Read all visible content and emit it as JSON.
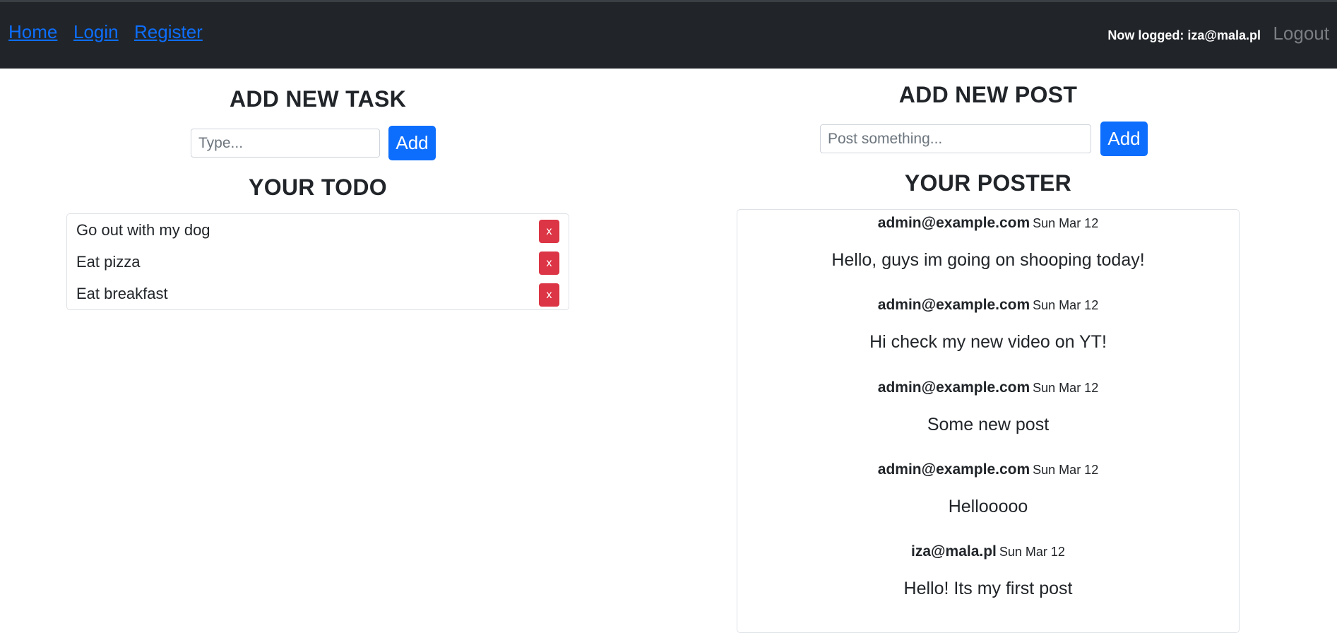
{
  "nav": {
    "links": [
      "Home",
      "Login",
      "Register"
    ],
    "user_label": "Now logged: iza@mala.pl",
    "logout": "Logout"
  },
  "tasks": {
    "heading": "ADD NEW TASK",
    "input_placeholder": "Type...",
    "add_label": "Add",
    "list_heading": "YOUR TODO",
    "items": [
      {
        "text": "Go out with my dog",
        "delete_label": "x"
      },
      {
        "text": "Eat pizza",
        "delete_label": "x"
      },
      {
        "text": "Eat breakfast",
        "delete_label": "x"
      }
    ]
  },
  "posts": {
    "heading": "ADD NEW POST",
    "input_placeholder": "Post something...",
    "add_label": "Add",
    "list_heading": "YOUR POSTER",
    "items": [
      {
        "author": "admin@example.com",
        "date": "Sun Mar 12",
        "body": "Hello, guys im going on shooping today!"
      },
      {
        "author": "admin@example.com",
        "date": "Sun Mar 12",
        "body": "Hi check my new video on YT!"
      },
      {
        "author": "admin@example.com",
        "date": "Sun Mar 12",
        "body": "Some new post"
      },
      {
        "author": "admin@example.com",
        "date": "Sun Mar 12",
        "body": "Hellooooo"
      },
      {
        "author": "iza@mala.pl",
        "date": "Sun Mar 12",
        "body": "Hello! Its my first post"
      }
    ]
  },
  "colors": {
    "navbar": "#212529",
    "link": "#0d6efd",
    "primary_button": "#0d6efd",
    "danger_button": "#dc3545"
  }
}
